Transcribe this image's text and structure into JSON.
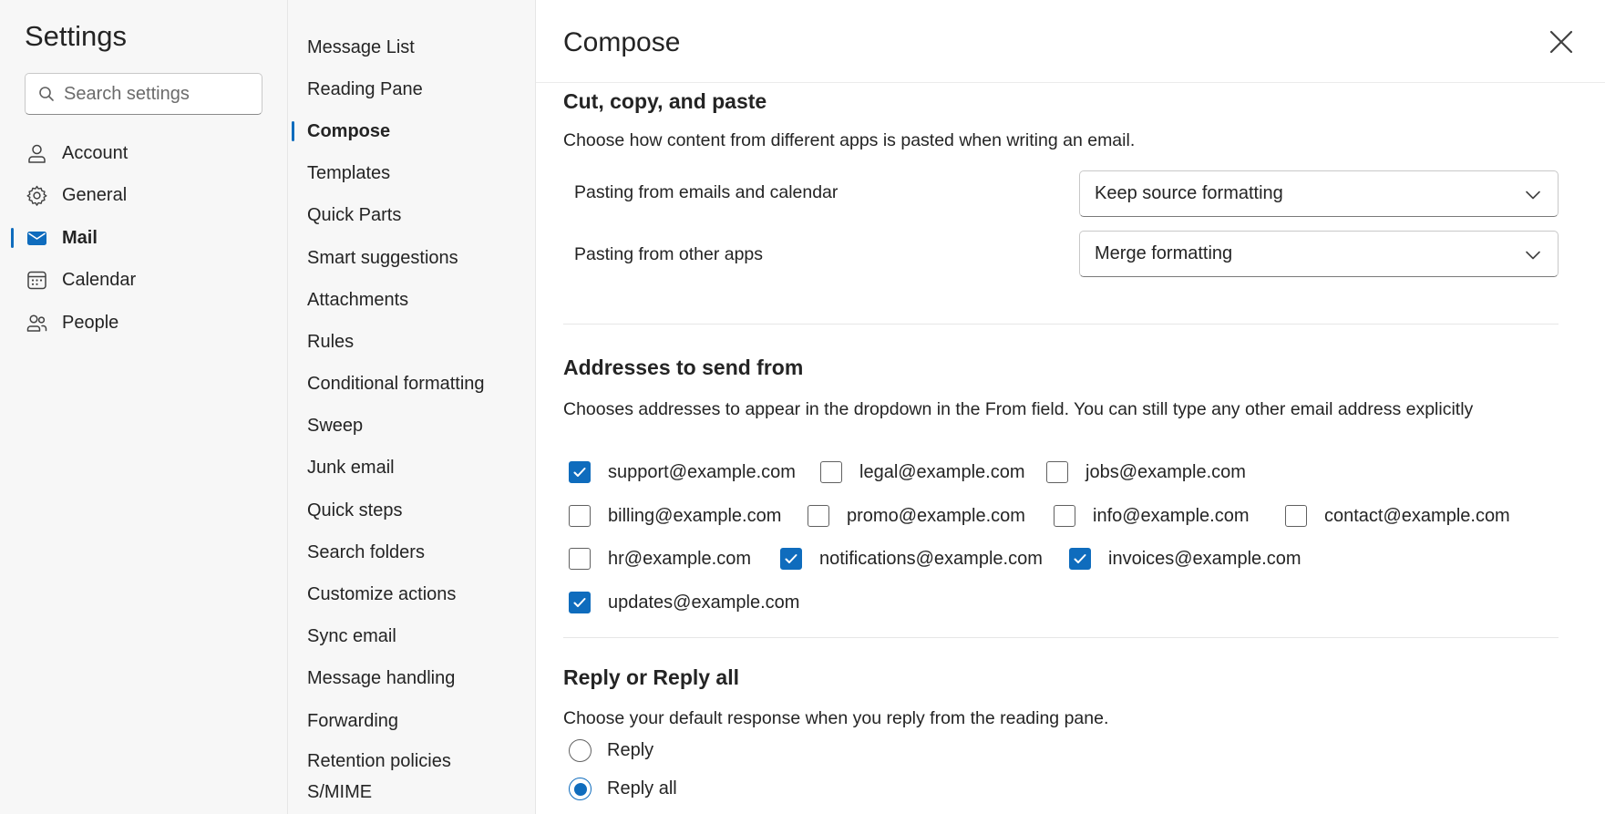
{
  "sidebar": {
    "title": "Settings",
    "search_placeholder": "Search settings",
    "categories": [
      {
        "label": "Account",
        "icon": "person-icon",
        "active": false
      },
      {
        "label": "General",
        "icon": "gear-icon",
        "active": false
      },
      {
        "label": "Mail",
        "icon": "mail-icon",
        "active": true
      },
      {
        "label": "Calendar",
        "icon": "calendar-icon",
        "active": false
      },
      {
        "label": "People",
        "icon": "people-icon",
        "active": false
      }
    ]
  },
  "subnav": {
    "items": [
      {
        "label": "Message List",
        "active": false
      },
      {
        "label": "Reading Pane",
        "active": false
      },
      {
        "label": "Compose",
        "active": true
      },
      {
        "label": "Templates",
        "active": false
      },
      {
        "label": "Quick Parts",
        "active": false
      },
      {
        "label": "Smart suggestions",
        "active": false
      },
      {
        "label": "Attachments",
        "active": false
      },
      {
        "label": "Rules",
        "active": false
      },
      {
        "label": "Conditional formatting",
        "active": false
      },
      {
        "label": "Sweep",
        "active": false
      },
      {
        "label": "Junk email",
        "active": false
      },
      {
        "label": "Quick steps",
        "active": false
      },
      {
        "label": "Search folders",
        "active": false
      },
      {
        "label": "Customize actions",
        "active": false
      },
      {
        "label": "Sync email",
        "active": false
      },
      {
        "label": "Message handling",
        "active": false
      },
      {
        "label": "Forwarding",
        "active": false
      },
      {
        "label": "Retention policies",
        "active": false
      },
      {
        "label": "S/MIME",
        "active": false
      }
    ]
  },
  "main": {
    "title": "Compose",
    "close_icon": "close-icon",
    "cut_copy_paste": {
      "title": "Cut, copy, and paste",
      "description": "Choose how content from different apps is pasted when writing an email.",
      "rows": [
        {
          "label": "Pasting from emails and calendar",
          "value": "Keep source formatting"
        },
        {
          "label": "Pasting from other apps",
          "value": "Merge formatting"
        }
      ]
    },
    "addresses": {
      "title": "Addresses to send from",
      "description": "Chooses addresses to appear in the dropdown in the From field. You can still type any other email address explicitly",
      "items": [
        {
          "email": "support@example.com",
          "checked": true
        },
        {
          "email": "legal@example.com",
          "checked": false
        },
        {
          "email": "jobs@example.com",
          "checked": false
        },
        {
          "email": "billing@example.com",
          "checked": false
        },
        {
          "email": "promo@example.com",
          "checked": false
        },
        {
          "email": "info@example.com",
          "checked": false
        },
        {
          "email": "contact@example.com",
          "checked": false
        },
        {
          "email": "hr@example.com",
          "checked": false
        },
        {
          "email": "notifications@example.com",
          "checked": true
        },
        {
          "email": "invoices@example.com",
          "checked": true
        },
        {
          "email": "updates@example.com",
          "checked": true
        }
      ]
    },
    "reply": {
      "title": "Reply or Reply all",
      "description": "Choose your default response when you reply from the reading pane.",
      "options": [
        {
          "label": "Reply",
          "selected": false
        },
        {
          "label": "Reply all",
          "selected": true
        }
      ]
    }
  },
  "colors": {
    "accent": "#0f6cbd",
    "pane_background": "#f7f7f7",
    "text": "#242424"
  }
}
